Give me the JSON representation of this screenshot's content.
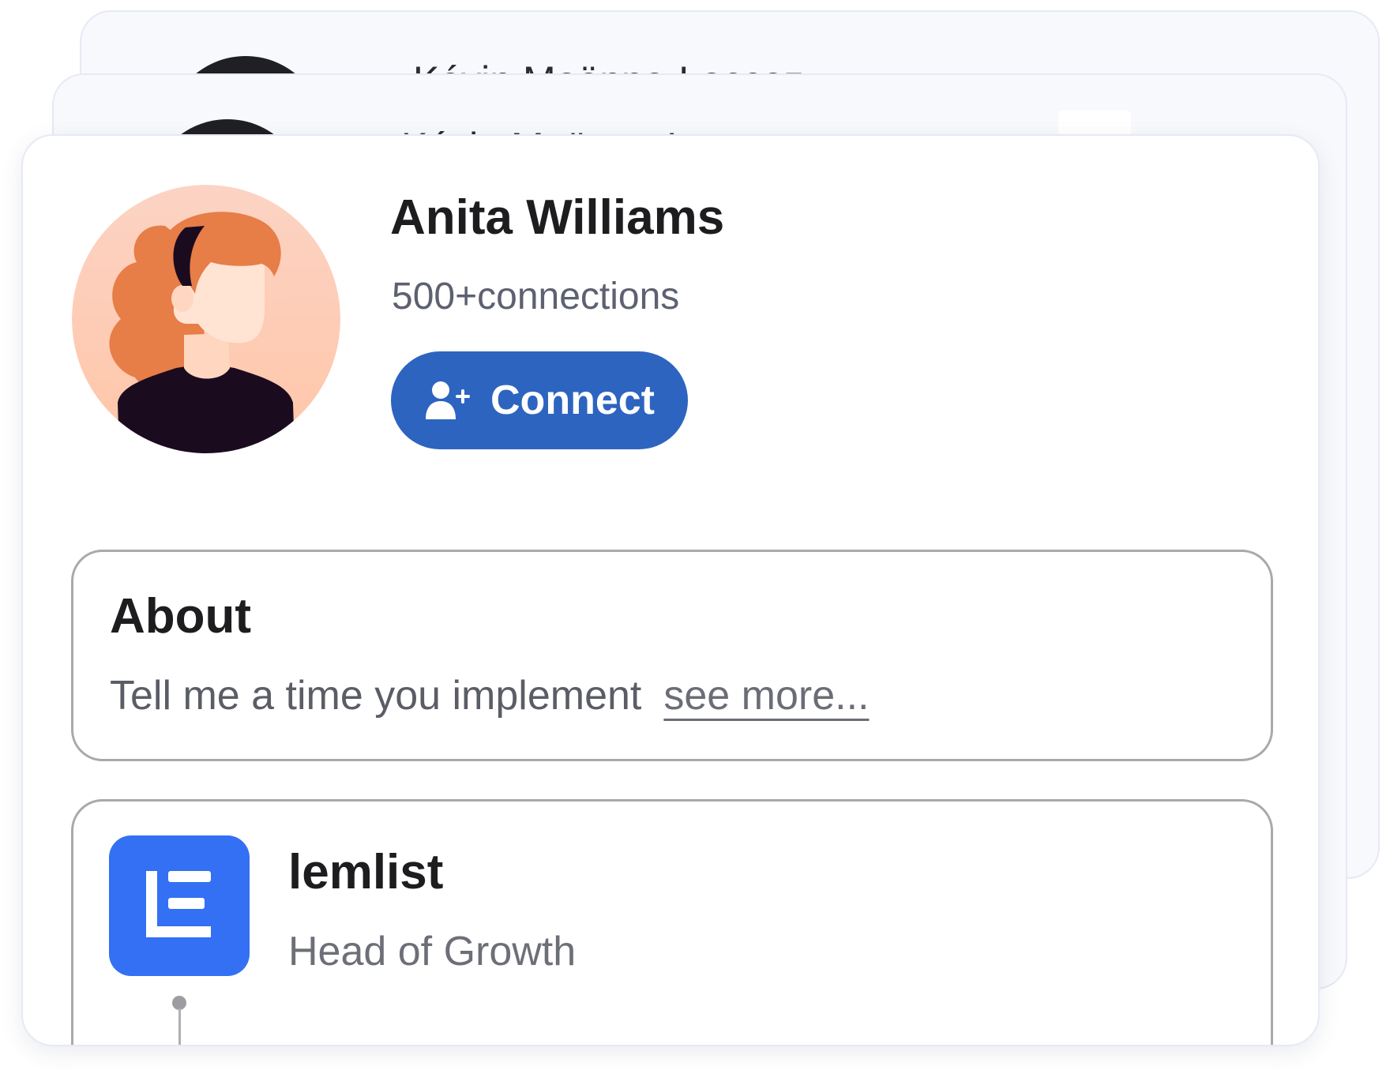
{
  "background_cards": [
    {
      "name": "Kévin Moënne-Loccoz"
    },
    {
      "name": "Kévin Moënne-Loccoz"
    }
  ],
  "profile": {
    "name": "Anita Williams",
    "connections": "500+connections",
    "connect_label": "Connect"
  },
  "about": {
    "title": "About",
    "text": "Tell me a time you implement",
    "see_more": "see more..."
  },
  "experience": {
    "company": "lemlist",
    "role": "Head of Growth"
  },
  "colors": {
    "accent_button": "#2d64bf",
    "company_logo": "#3370f3",
    "avatar_bg": "#fdd0bd",
    "hair": "#e77d47"
  }
}
